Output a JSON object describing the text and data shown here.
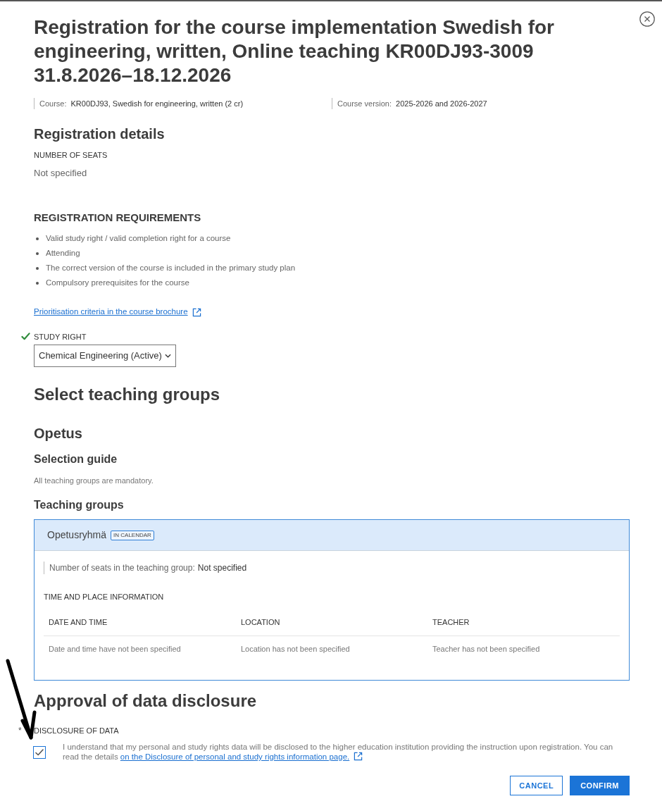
{
  "title": "Registration for the course implementation Swedish for engineering, written, Online teaching KR00DJ93-3009 31.8.2026–18.12.2026",
  "course_info": [
    {
      "label": "Course:",
      "value": "KR00DJ93, Swedish for engineering, written (2 cr)"
    },
    {
      "label": "Course version:",
      "value": "2025-2026 and 2026-2027"
    }
  ],
  "registration_details": {
    "heading": "Registration details",
    "seats_label": "NUMBER OF SEATS",
    "seats_value": "Not specified"
  },
  "requirements": {
    "heading": "REGISTRATION REQUIREMENTS",
    "items": [
      "Valid study right / valid completion right for a course",
      "Attending",
      "The correct version of the course is included in the primary study plan",
      "Compulsory prerequisites for the course"
    ]
  },
  "prioritisation_link": "Prioritisation criteria in the course brochure",
  "study_right": {
    "label": "STUDY RIGHT",
    "valid": true,
    "value": "Chemical Engineering (Active)"
  },
  "teaching_groups_section": {
    "heading": "Select teaching groups",
    "subheading": "Opetus",
    "guide_heading": "Selection guide",
    "guide_text": "All teaching groups are mandatory.",
    "groups_heading": "Teaching groups",
    "groups": [
      {
        "name": "Opetusryhmä",
        "badge": "IN CALENDAR",
        "selected": true,
        "seats_label": "Number of seats in the teaching group:",
        "seats_value": "Not specified",
        "info_heading": "TIME AND PLACE INFORMATION",
        "table": {
          "columns": [
            "DATE AND TIME",
            "LOCATION",
            "TEACHER"
          ],
          "rows": [
            [
              "Date and time have not been specified",
              "Location has not been specified",
              "Teacher has not been specified"
            ]
          ]
        }
      }
    ]
  },
  "data_disclosure": {
    "heading": "Approval of data disclosure",
    "required_mark": "*",
    "label": "DISCLOSURE OF DATA",
    "checked": true,
    "text": "I understand that my personal and study rights data will be disclosed to the higher education institution providing the instruction upon registration. You can read the details",
    "link": "on the Disclosure of personal and study rights information page."
  },
  "buttons": [
    {
      "label": "CANCEL",
      "kind": "secondary"
    },
    {
      "label": "CONFIRM",
      "kind": "primary"
    }
  ]
}
